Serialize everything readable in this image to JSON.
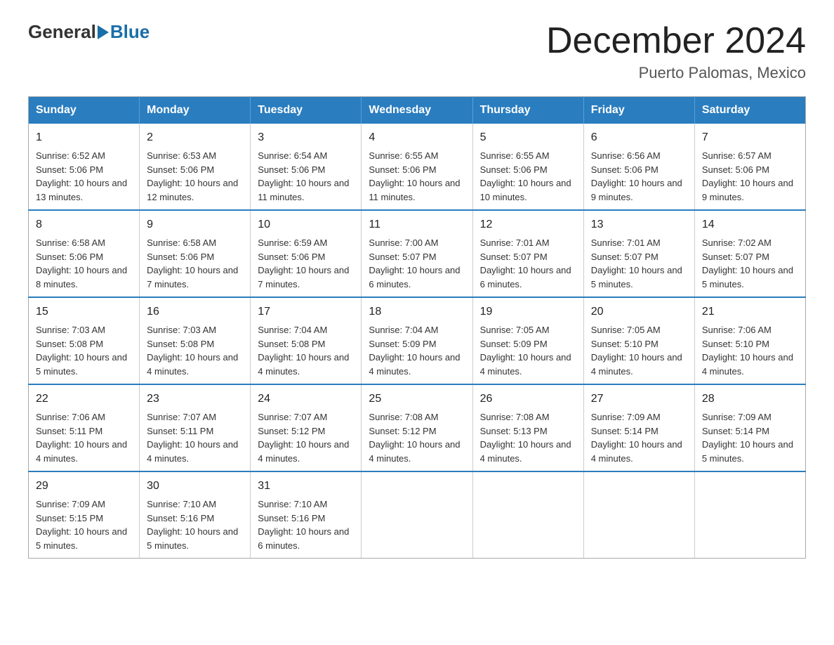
{
  "header": {
    "logo_general": "General",
    "logo_blue": "Blue",
    "month_title": "December 2024",
    "location": "Puerto Palomas, Mexico"
  },
  "weekdays": [
    "Sunday",
    "Monday",
    "Tuesday",
    "Wednesday",
    "Thursday",
    "Friday",
    "Saturday"
  ],
  "weeks": [
    [
      {
        "day": "1",
        "sunrise": "6:52 AM",
        "sunset": "5:06 PM",
        "daylight": "10 hours and 13 minutes."
      },
      {
        "day": "2",
        "sunrise": "6:53 AM",
        "sunset": "5:06 PM",
        "daylight": "10 hours and 12 minutes."
      },
      {
        "day": "3",
        "sunrise": "6:54 AM",
        "sunset": "5:06 PM",
        "daylight": "10 hours and 11 minutes."
      },
      {
        "day": "4",
        "sunrise": "6:55 AM",
        "sunset": "5:06 PM",
        "daylight": "10 hours and 11 minutes."
      },
      {
        "day": "5",
        "sunrise": "6:55 AM",
        "sunset": "5:06 PM",
        "daylight": "10 hours and 10 minutes."
      },
      {
        "day": "6",
        "sunrise": "6:56 AM",
        "sunset": "5:06 PM",
        "daylight": "10 hours and 9 minutes."
      },
      {
        "day": "7",
        "sunrise": "6:57 AM",
        "sunset": "5:06 PM",
        "daylight": "10 hours and 9 minutes."
      }
    ],
    [
      {
        "day": "8",
        "sunrise": "6:58 AM",
        "sunset": "5:06 PM",
        "daylight": "10 hours and 8 minutes."
      },
      {
        "day": "9",
        "sunrise": "6:58 AM",
        "sunset": "5:06 PM",
        "daylight": "10 hours and 7 minutes."
      },
      {
        "day": "10",
        "sunrise": "6:59 AM",
        "sunset": "5:06 PM",
        "daylight": "10 hours and 7 minutes."
      },
      {
        "day": "11",
        "sunrise": "7:00 AM",
        "sunset": "5:07 PM",
        "daylight": "10 hours and 6 minutes."
      },
      {
        "day": "12",
        "sunrise": "7:01 AM",
        "sunset": "5:07 PM",
        "daylight": "10 hours and 6 minutes."
      },
      {
        "day": "13",
        "sunrise": "7:01 AM",
        "sunset": "5:07 PM",
        "daylight": "10 hours and 5 minutes."
      },
      {
        "day": "14",
        "sunrise": "7:02 AM",
        "sunset": "5:07 PM",
        "daylight": "10 hours and 5 minutes."
      }
    ],
    [
      {
        "day": "15",
        "sunrise": "7:03 AM",
        "sunset": "5:08 PM",
        "daylight": "10 hours and 5 minutes."
      },
      {
        "day": "16",
        "sunrise": "7:03 AM",
        "sunset": "5:08 PM",
        "daylight": "10 hours and 4 minutes."
      },
      {
        "day": "17",
        "sunrise": "7:04 AM",
        "sunset": "5:08 PM",
        "daylight": "10 hours and 4 minutes."
      },
      {
        "day": "18",
        "sunrise": "7:04 AM",
        "sunset": "5:09 PM",
        "daylight": "10 hours and 4 minutes."
      },
      {
        "day": "19",
        "sunrise": "7:05 AM",
        "sunset": "5:09 PM",
        "daylight": "10 hours and 4 minutes."
      },
      {
        "day": "20",
        "sunrise": "7:05 AM",
        "sunset": "5:10 PM",
        "daylight": "10 hours and 4 minutes."
      },
      {
        "day": "21",
        "sunrise": "7:06 AM",
        "sunset": "5:10 PM",
        "daylight": "10 hours and 4 minutes."
      }
    ],
    [
      {
        "day": "22",
        "sunrise": "7:06 AM",
        "sunset": "5:11 PM",
        "daylight": "10 hours and 4 minutes."
      },
      {
        "day": "23",
        "sunrise": "7:07 AM",
        "sunset": "5:11 PM",
        "daylight": "10 hours and 4 minutes."
      },
      {
        "day": "24",
        "sunrise": "7:07 AM",
        "sunset": "5:12 PM",
        "daylight": "10 hours and 4 minutes."
      },
      {
        "day": "25",
        "sunrise": "7:08 AM",
        "sunset": "5:12 PM",
        "daylight": "10 hours and 4 minutes."
      },
      {
        "day": "26",
        "sunrise": "7:08 AM",
        "sunset": "5:13 PM",
        "daylight": "10 hours and 4 minutes."
      },
      {
        "day": "27",
        "sunrise": "7:09 AM",
        "sunset": "5:14 PM",
        "daylight": "10 hours and 4 minutes."
      },
      {
        "day": "28",
        "sunrise": "7:09 AM",
        "sunset": "5:14 PM",
        "daylight": "10 hours and 5 minutes."
      }
    ],
    [
      {
        "day": "29",
        "sunrise": "7:09 AM",
        "sunset": "5:15 PM",
        "daylight": "10 hours and 5 minutes."
      },
      {
        "day": "30",
        "sunrise": "7:10 AM",
        "sunset": "5:16 PM",
        "daylight": "10 hours and 5 minutes."
      },
      {
        "day": "31",
        "sunrise": "7:10 AM",
        "sunset": "5:16 PM",
        "daylight": "10 hours and 6 minutes."
      },
      null,
      null,
      null,
      null
    ]
  ]
}
